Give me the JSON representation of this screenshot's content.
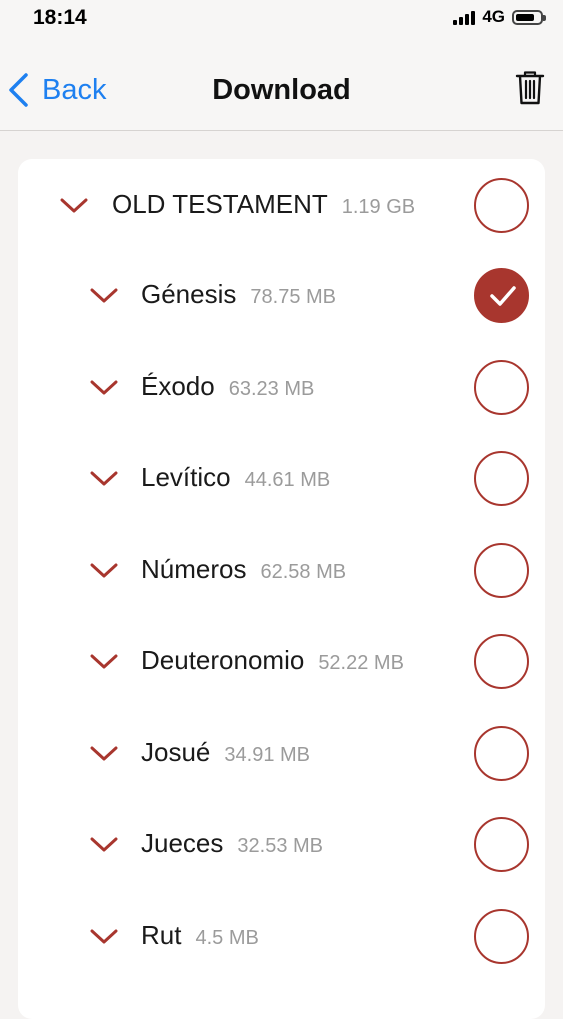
{
  "status_bar": {
    "time": "18:14",
    "network": "4G",
    "signal_bars": 4,
    "battery_level": 0.8
  },
  "nav": {
    "back_label": "Back",
    "title": "Download"
  },
  "colors": {
    "accent": "#a8362e",
    "link": "#1e80f0",
    "size_text": "#9b9b9b"
  },
  "section": {
    "label": "OLD TESTAMENT",
    "size": "1.19 GB",
    "selected": false
  },
  "books": [
    {
      "name": "Génesis",
      "size": "78.75 MB",
      "selected": true
    },
    {
      "name": "Éxodo",
      "size": "63.23 MB",
      "selected": false
    },
    {
      "name": "Levítico",
      "size": "44.61 MB",
      "selected": false
    },
    {
      "name": "Números",
      "size": "62.58 MB",
      "selected": false
    },
    {
      "name": "Deuteronomio",
      "size": "52.22 MB",
      "selected": false
    },
    {
      "name": "Josué",
      "size": "34.91 MB",
      "selected": false
    },
    {
      "name": "Jueces",
      "size": "32.53 MB",
      "selected": false
    },
    {
      "name": "Rut",
      "size": "4.5 MB",
      "selected": false
    }
  ]
}
